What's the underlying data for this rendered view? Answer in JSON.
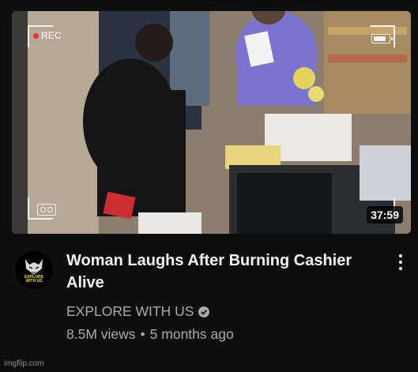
{
  "thumbnail": {
    "rec_label": "REC",
    "duration": "37:59"
  },
  "channel": {
    "avatar_text": "EXPLORE WITH US",
    "name": "EXPLORE WITH US",
    "verified": true
  },
  "video": {
    "title": "Woman Laughs After Burning Cashier Alive",
    "views": "8.5M views",
    "separator": "•",
    "age": "5 months ago"
  },
  "watermark": "imgflip.com",
  "colors": {
    "background": "#0f0f0f",
    "title": "#f1f1f1",
    "secondary": "#aaaaaa",
    "rec_dot": "#ff2a2a"
  },
  "icons": [
    "rec-dot-icon",
    "battery-icon",
    "tape-icon",
    "more-vert-icon",
    "verified-check-icon"
  ]
}
